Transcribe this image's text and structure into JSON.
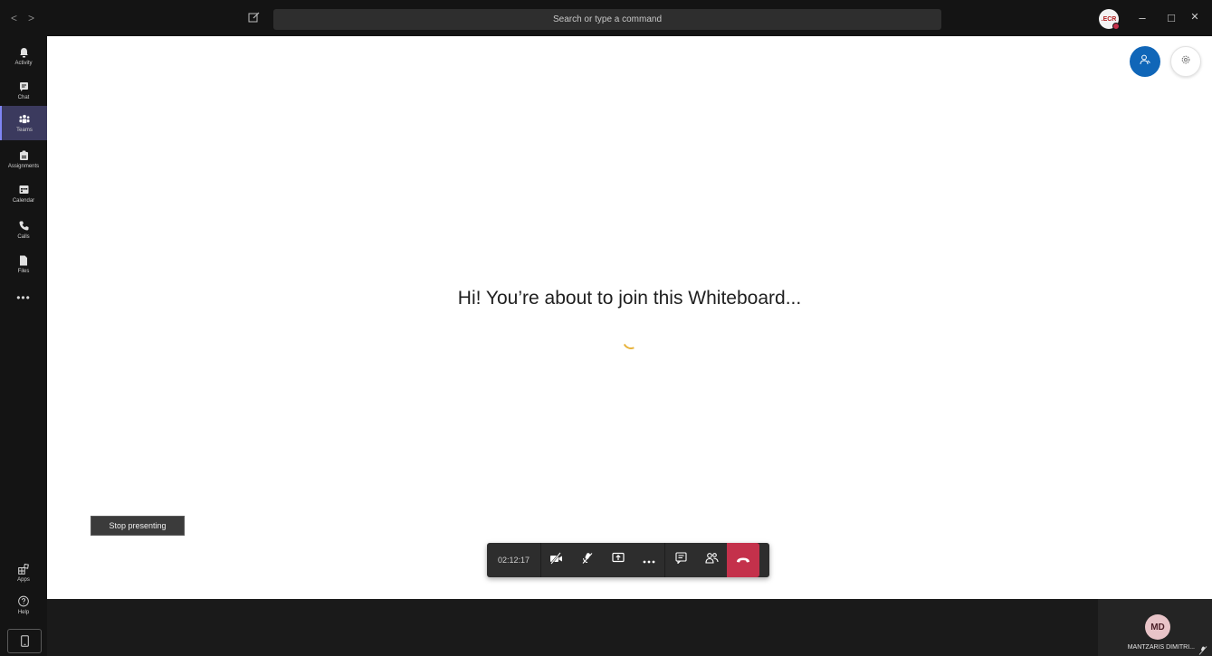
{
  "titlebar": {
    "search_placeholder": "Search or type a command",
    "avatar_initials": ".ECR",
    "nav_back": "<",
    "nav_forward": ">",
    "minimize": "–",
    "maximize": "□",
    "close": "✕"
  },
  "rail": {
    "items": [
      {
        "label": "Activity",
        "icon": "bell-icon"
      },
      {
        "label": "Chat",
        "icon": "chat-icon"
      },
      {
        "label": "Teams",
        "icon": "teams-icon",
        "active": true
      },
      {
        "label": "Assignments",
        "icon": "assignments-icon"
      },
      {
        "label": "Calendar",
        "icon": "calendar-icon"
      },
      {
        "label": "Calls",
        "icon": "phone-icon"
      },
      {
        "label": "Files",
        "icon": "file-icon"
      }
    ],
    "more": "•••",
    "apps_label": "Apps",
    "help_label": "Help"
  },
  "stage": {
    "message": "Hi! You’re about to join this Whiteboard..."
  },
  "meeting": {
    "stop_presenting": "Stop presenting",
    "timer": "02:12:17"
  },
  "self": {
    "initials": "MD",
    "name": "MANTZARIS DIMITRI..."
  },
  "colors": {
    "accent": "#1066b8",
    "hangup": "#c4314b",
    "rail_active": "#3b3a5e",
    "spinner": "#e8b33c"
  }
}
